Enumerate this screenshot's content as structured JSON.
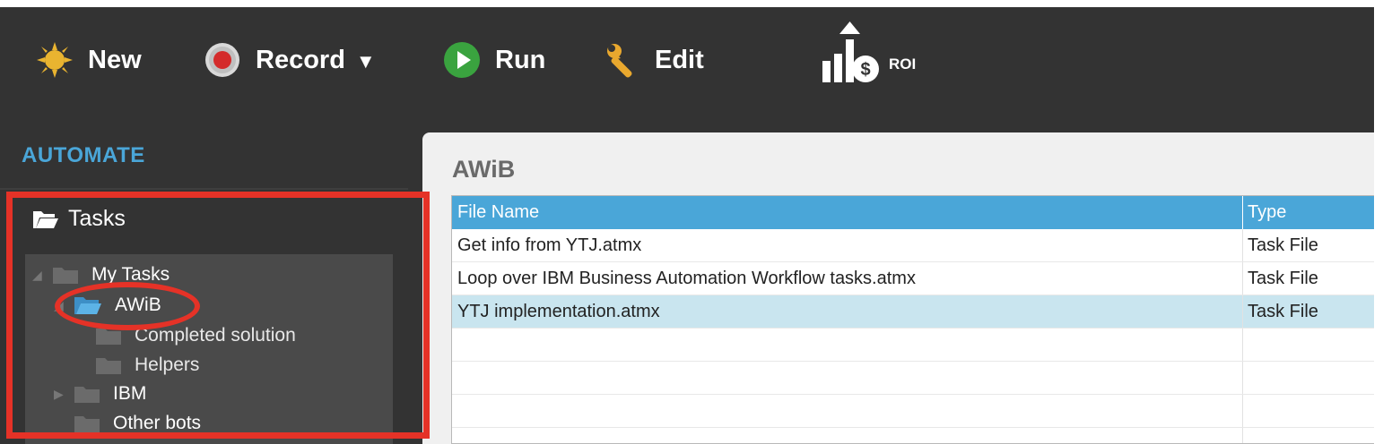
{
  "toolbar": {
    "new_label": "New",
    "record_label": "Record",
    "record_caret": "▼",
    "run_label": "Run",
    "edit_label": "Edit",
    "roi_label": "ROI"
  },
  "sidebar": {
    "section_title": "AUTOMATE",
    "tasks_label": "Tasks",
    "tree": [
      {
        "label": "My Tasks",
        "level": 0
      },
      {
        "label": "AWiB",
        "level": 1
      },
      {
        "label": "Completed solution",
        "level": 2
      },
      {
        "label": "Helpers",
        "level": 2
      },
      {
        "label": "IBM",
        "level": 1
      },
      {
        "label": "Other bots",
        "level": 1
      }
    ]
  },
  "main": {
    "title": "AWiB",
    "columns": [
      "File Name",
      "Type"
    ],
    "rows": [
      {
        "name": "Get info from YTJ.atmx",
        "type": "Task File"
      },
      {
        "name": "Loop over IBM Business Automation Workflow tasks.atmx",
        "type": "Task File"
      },
      {
        "name": "YTJ implementation.atmx",
        "type": "Task File"
      }
    ],
    "selected_row": 2
  },
  "colors": {
    "accent": "#4aa6d8",
    "annotation_red": "#e53227",
    "toolbar_bg": "#333333",
    "selected_row": "#c9e5ef"
  }
}
